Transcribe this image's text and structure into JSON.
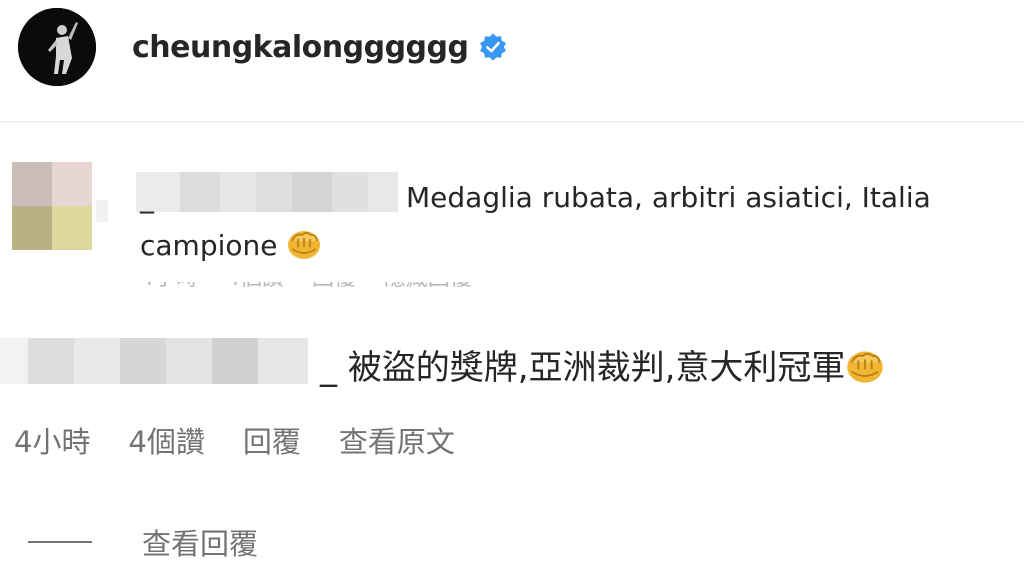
{
  "header": {
    "username": "cheungkalongggggg",
    "verified_icon": "verified-badge-icon",
    "avatar_icon": "profile-avatar"
  },
  "comments": [
    {
      "username": "_",
      "text": "Medaglia rubata, arbitri asiatici, Italia campione",
      "emoji": "oncoming-fist-icon"
    },
    {
      "username": "_",
      "text": "被盜的獎牌,亞洲裁判,意大利冠軍",
      "emoji": "oncoming-fist-icon",
      "time": "4小時",
      "likes": "4個讚",
      "reply": "回覆",
      "see_translation": "查看原文"
    }
  ],
  "view_replies": {
    "label": "查看回覆"
  },
  "colors": {
    "text": "#262626",
    "secondary": "#737373",
    "verified": "#3897f0",
    "fist": "#f2b533"
  }
}
